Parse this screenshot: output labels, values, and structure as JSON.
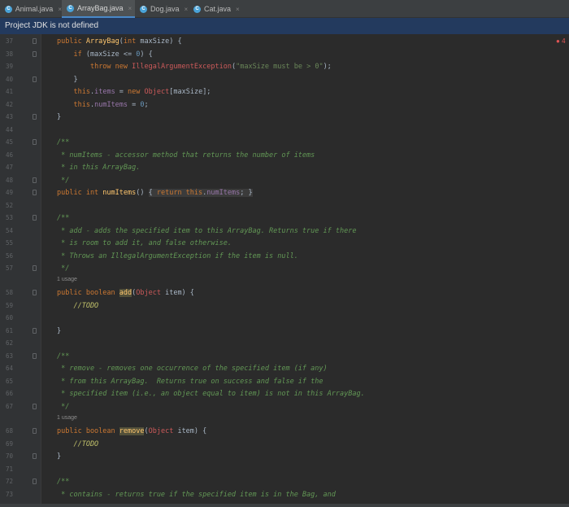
{
  "tabs": [
    {
      "label": "Animal.java",
      "icon": "C",
      "close": "×"
    },
    {
      "label": "ArrayBag.java",
      "icon": "C",
      "close": "×"
    },
    {
      "label": "Dog.java",
      "icon": "C",
      "close": "×"
    },
    {
      "label": "Cat.java",
      "icon": "C",
      "close": "×"
    }
  ],
  "banner": "Project JDK is not defined",
  "error_count": "4",
  "usage_label": "1 usage",
  "lines": [
    {
      "n": "37",
      "t": "public ArrayBag(int maxSize) {"
    },
    {
      "n": "38",
      "t": "    if (maxSize <= 0) {"
    },
    {
      "n": "39",
      "t": "        throw new IllegalArgumentException(\"maxSize must be > 0\");"
    },
    {
      "n": "40",
      "t": "    }"
    },
    {
      "n": "41",
      "t": "    this.items = new Object[maxSize];"
    },
    {
      "n": "42",
      "t": "    this.numItems = 0;"
    },
    {
      "n": "43",
      "t": "}"
    },
    {
      "n": "44",
      "t": ""
    },
    {
      "n": "45",
      "t": "/**"
    },
    {
      "n": "46",
      "t": " * numItems - accessor method that returns the number of items"
    },
    {
      "n": "47",
      "t": " * in this ArrayBag."
    },
    {
      "n": "48",
      "t": " */"
    },
    {
      "n": "49",
      "t": "public int numItems() { return this.numItems; }"
    },
    {
      "n": "52",
      "t": ""
    },
    {
      "n": "53",
      "t": "/**"
    },
    {
      "n": "54",
      "t": " * add - adds the specified item to this ArrayBag. Returns true if there"
    },
    {
      "n": "55",
      "t": " * is room to add it, and false otherwise."
    },
    {
      "n": "56",
      "t": " * Throws an IllegalArgumentException if the item is null."
    },
    {
      "n": "57",
      "t": " */"
    },
    {
      "n": "58",
      "t": "public boolean add(Object item) {"
    },
    {
      "n": "59",
      "t": "    //TODO"
    },
    {
      "n": "60",
      "t": ""
    },
    {
      "n": "61",
      "t": "}"
    },
    {
      "n": "62",
      "t": ""
    },
    {
      "n": "63",
      "t": "/**"
    },
    {
      "n": "64",
      "t": " * remove - removes one occurrence of the specified item (if any)"
    },
    {
      "n": "65",
      "t": " * from this ArrayBag.  Returns true on success and false if the"
    },
    {
      "n": "66",
      "t": " * specified item (i.e., an object equal to item) is not in this ArrayBag."
    },
    {
      "n": "67",
      "t": " */"
    },
    {
      "n": "68",
      "t": "public boolean remove(Object item) {"
    },
    {
      "n": "69",
      "t": "    //TODO"
    },
    {
      "n": "70",
      "t": "}"
    },
    {
      "n": "71",
      "t": ""
    },
    {
      "n": "72",
      "t": "/**"
    },
    {
      "n": "73",
      "t": " * contains - returns true if the specified item is in the Bag, and"
    }
  ]
}
